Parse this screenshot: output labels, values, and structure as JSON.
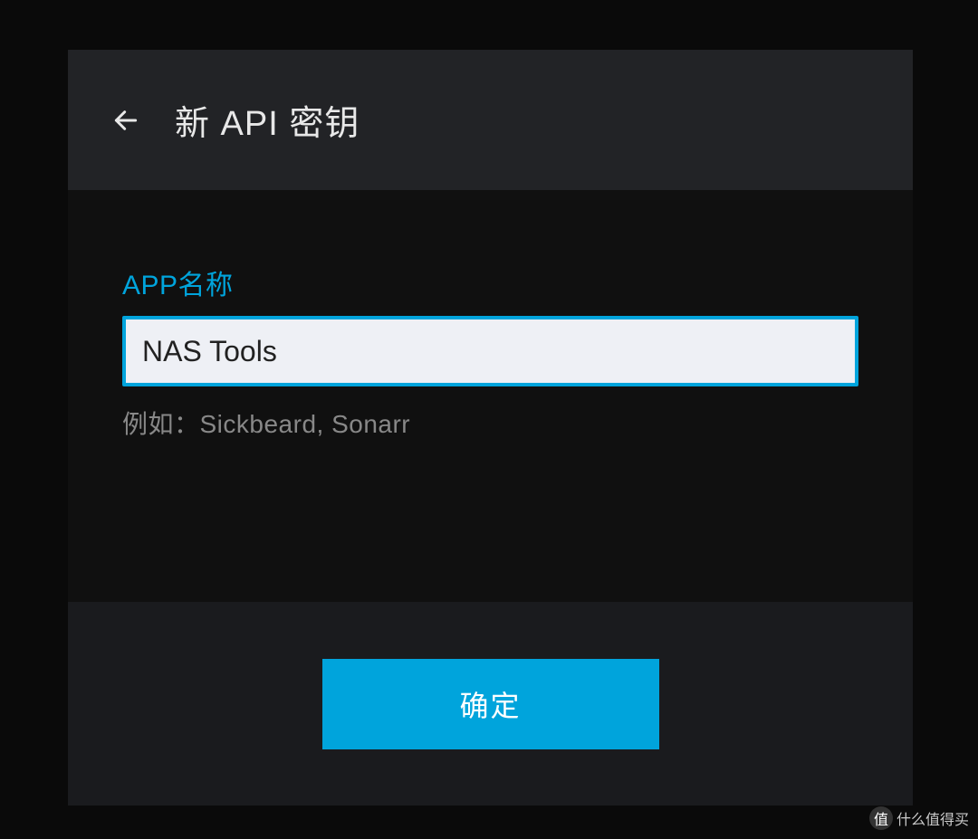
{
  "dialog": {
    "title": "新 API 密钥",
    "fieldLabel": "APP名称",
    "fieldValue": "NAS Tools",
    "fieldHint": "例如：Sickbeard, Sonarr",
    "okLabel": "确定"
  },
  "watermark": {
    "badge": "值",
    "text": "什么值得买"
  },
  "colors": {
    "accent": "#00a4dc",
    "bgDark": "#0a0a0a",
    "panel": "#101010",
    "header": "#222326",
    "footer": "#1a1b1e",
    "inputBg": "#eef0f5"
  }
}
